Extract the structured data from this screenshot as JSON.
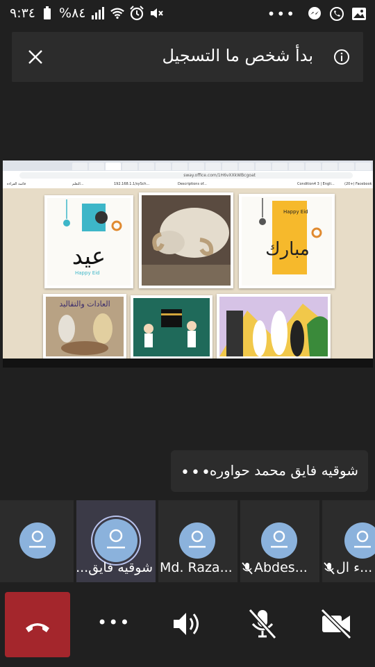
{
  "status_bar": {
    "time": "٩:٣٤",
    "battery": "%٨٤"
  },
  "banner": {
    "title": "بدأ شخص ما التسجيل"
  },
  "shared_screen": {
    "browser": {
      "url": "sway.office.com/1H6vXXkWBcgoat",
      "bookmarks": [
        "قائمة القراءة",
        "Descriptions of...",
        "Condition4 3 | Engli...",
        "(20+) Facebook",
        "192.168.1.1/sySch...",
        "التعلم..."
      ]
    },
    "cards": [
      {
        "name": "eid-card-1",
        "text": "عيد",
        "subtext": "Happy Eid"
      },
      {
        "name": "sheep-photo"
      },
      {
        "name": "eid-card-2",
        "text": "مبارك",
        "subtext": "Happy Eid"
      },
      {
        "name": "customs-card",
        "text": "العادات والتقاليد"
      },
      {
        "name": "kaaba-card"
      },
      {
        "name": "people-card"
      }
    ]
  },
  "participant_card": {
    "name": "شوقيه فايق محمد حواوره",
    "more_label": "•••"
  },
  "participants": [
    {
      "label": ""
    },
    {
      "label": "شوقيه فايق..."
    },
    {
      "label": "Md. Raza..."
    },
    {
      "label": "Abdes..."
    },
    {
      "label": "ء ال..."
    }
  ],
  "controls": {
    "more_label": "•••"
  }
}
